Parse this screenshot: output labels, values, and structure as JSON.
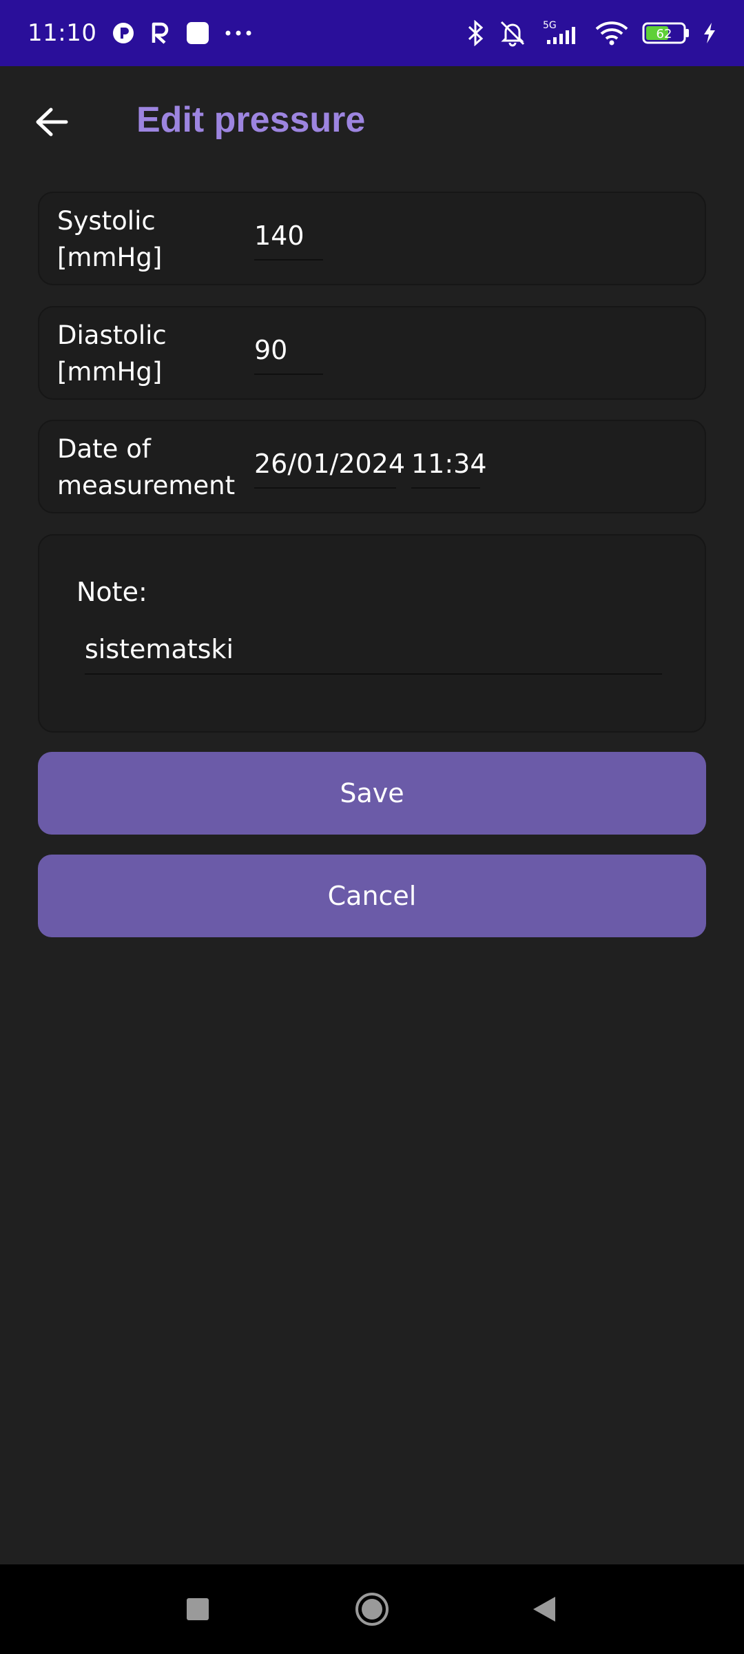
{
  "status_bar": {
    "time": "11:10",
    "battery_level": "62",
    "network_type": "5G"
  },
  "header": {
    "title": "Edit pressure"
  },
  "form": {
    "systolic": {
      "label_line1": "Systolic",
      "label_line2": "[mmHg]",
      "value": "140"
    },
    "diastolic": {
      "label_line1": "Diastolic",
      "label_line2": "[mmHg]",
      "value": "90"
    },
    "date": {
      "label_line1": "Date of",
      "label_line2": "measurement",
      "date_value": "26/01/2024",
      "time_value": "11:34"
    },
    "note": {
      "label": "Note:",
      "value": "sistematski"
    }
  },
  "actions": {
    "save_label": "Save",
    "cancel_label": "Cancel"
  },
  "colors": {
    "status_bar": "#2a0f9a",
    "background": "#202020",
    "title": "#9d85e0",
    "button": "#6b5ba8"
  }
}
